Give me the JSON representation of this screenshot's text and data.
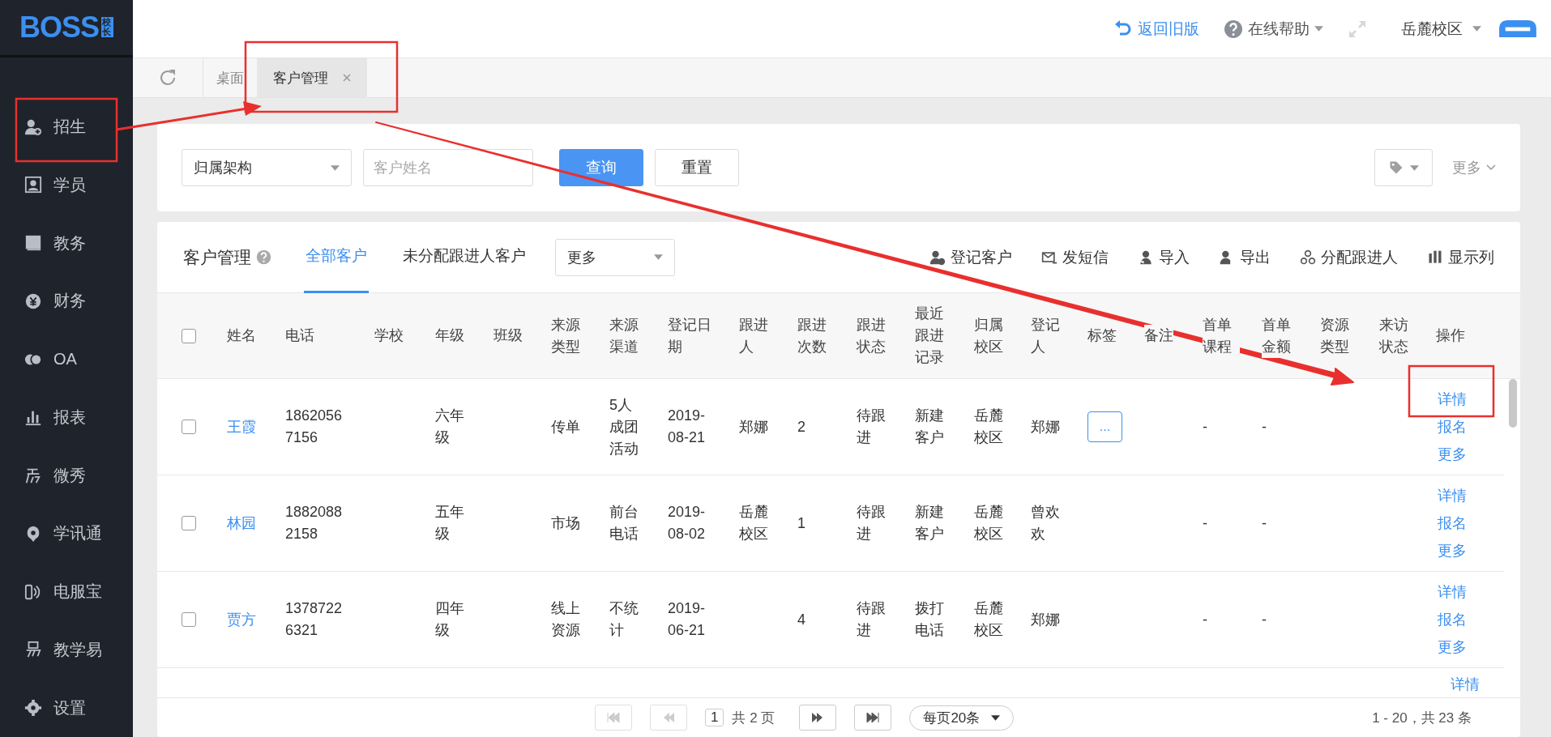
{
  "header": {
    "logo": "BOSS",
    "logo_badge": "校长",
    "links": [
      {
        "kind": "back",
        "label": "返回旧版"
      },
      {
        "kind": "help",
        "label": "在线帮助"
      }
    ],
    "campus": "岳麓校区"
  },
  "sidebar": {
    "items": [
      {
        "label": "招生"
      },
      {
        "label": "学员"
      },
      {
        "label": "教务"
      },
      {
        "label": "财务"
      },
      {
        "label": "OA"
      },
      {
        "label": "报表"
      },
      {
        "label": "微秀"
      },
      {
        "label": "学讯通"
      },
      {
        "label": "电服宝"
      },
      {
        "label": "教学易"
      },
      {
        "label": "设置"
      }
    ]
  },
  "tabs": [
    {
      "label": "桌面",
      "selected": false,
      "closable": false
    },
    {
      "label": "客户管理",
      "selected": true,
      "closable": true
    }
  ],
  "filter": {
    "select": "归属架构",
    "search": {
      "placeholder": "客户姓名"
    },
    "buttons": [
      {
        "label": "查询",
        "primary": true
      },
      {
        "label": "重置",
        "primary": false
      }
    ],
    "more": "更多"
  },
  "list": {
    "title": "客户管理",
    "tabs": [
      {
        "label": "全部客户",
        "selected": true
      },
      {
        "label": "未分配跟进人客户",
        "selected": false
      }
    ],
    "select": "更多",
    "actions": [
      "登记客户",
      "发短信",
      "导入",
      "导出",
      "分配跟进人",
      "显示列"
    ]
  },
  "table": {
    "select_all": {
      "checked": false
    },
    "columns": [
      "姓名",
      "电话",
      "学校",
      "年级",
      "班级",
      "来源类型",
      "来源渠道",
      "登记日期",
      "跟进人",
      "跟进次数",
      "跟进状态",
      "最近跟进记录",
      "归属校区",
      "登记人",
      "标签",
      "备注",
      "首单课程",
      "首单金额",
      "资源类型",
      "来访状态",
      "操作"
    ],
    "rows": [
      {
        "checked": false,
        "name": "王霞",
        "phone": "18620567156",
        "grade": "六年级",
        "source_type": "传单",
        "channel": "5人成团活动",
        "date": "2019-08-21",
        "follower": "郑娜",
        "count": "2",
        "status": "待跟进",
        "last_record": "新建客户",
        "campus": "岳麓校区",
        "registrar": "郑娜",
        "tag": "...",
        "first_course": "-",
        "first_amount": "-",
        "actions": [
          "详情",
          "报名",
          "更多"
        ]
      },
      {
        "checked": false,
        "name": "林园",
        "phone": "18820882158",
        "grade": "五年级",
        "source_type": "市场",
        "channel": "前台电话",
        "date": "2019-08-02",
        "follower": "岳麓校区",
        "count": "1",
        "status": "待跟进",
        "last_record": "新建客户",
        "campus": "岳麓校区",
        "registrar": "曾欢欢",
        "first_course": "-",
        "first_amount": "-",
        "actions": [
          "详情",
          "报名",
          "更多"
        ]
      },
      {
        "checked": false,
        "name": "贾方",
        "phone": "13787226321",
        "grade": "四年级",
        "source_type": "线上资源",
        "channel": "不统计",
        "date": "2019-06-21",
        "count": "4",
        "status": "待跟进",
        "last_record": "拨打电话",
        "campus": "岳麓校区",
        "registrar": "郑娜",
        "first_course": "-",
        "first_amount": "-",
        "actions": [
          "详情",
          "报名",
          "更多"
        ]
      }
    ],
    "partial_row": {
      "actions": [
        "详情"
      ]
    }
  },
  "pagination": {
    "page": "1",
    "pages": "共 2 页",
    "page_size": "每页20条",
    "summary": "1 - 20，共 23 条"
  }
}
